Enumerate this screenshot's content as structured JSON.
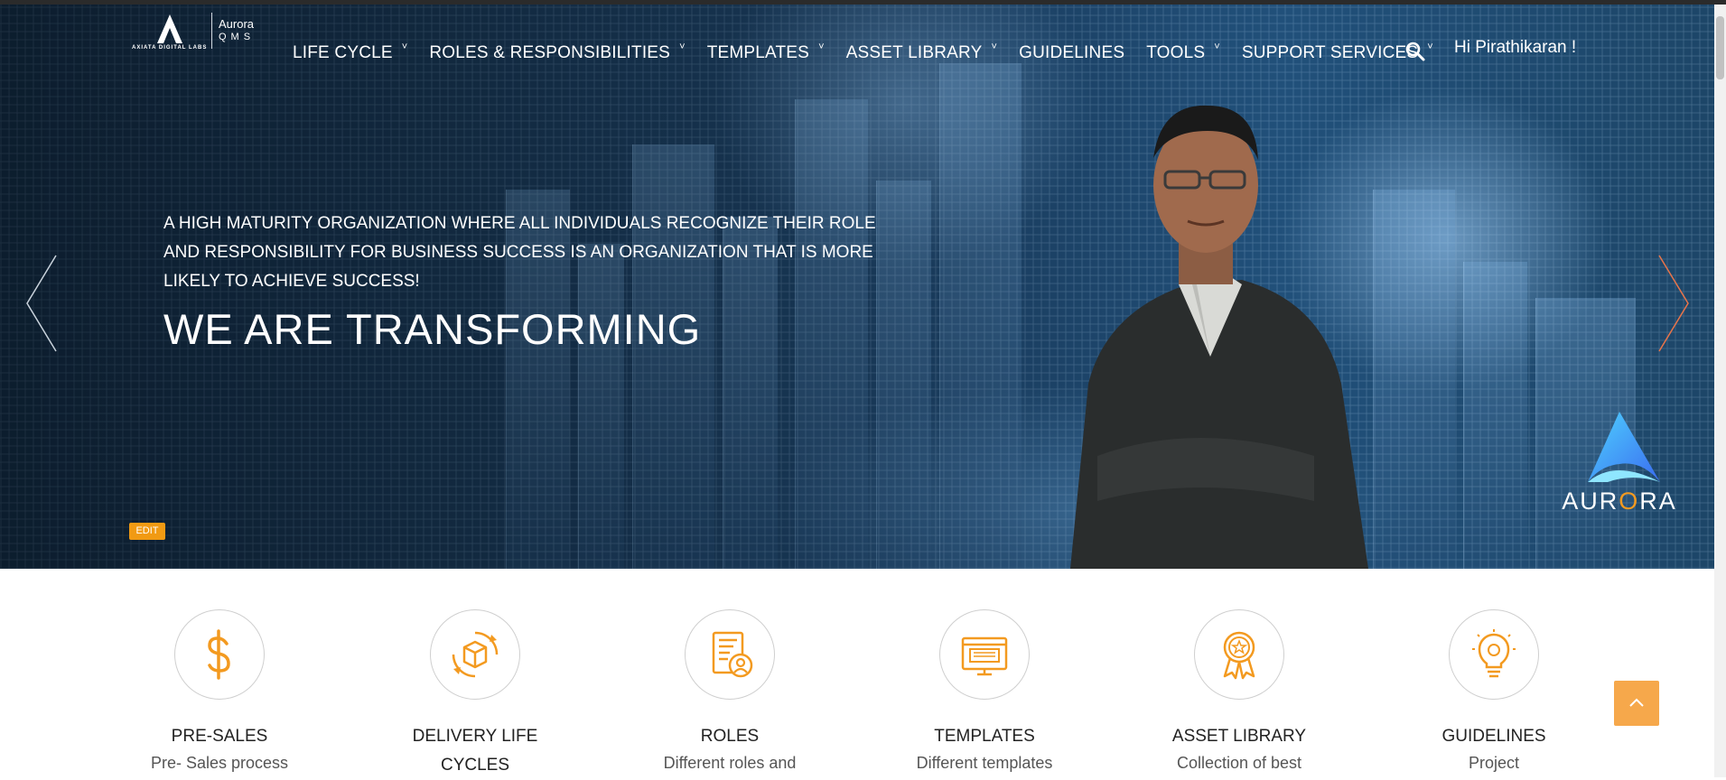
{
  "logo": {
    "brand_sub": "AXIATA DIGITAL LABS",
    "product_name": "Aurora",
    "product_suffix": "QMS"
  },
  "nav": {
    "items": [
      {
        "label": "LIFE CYCLE",
        "has_dropdown": true
      },
      {
        "label": "ROLES & RESPONSIBILITIES",
        "has_dropdown": true
      },
      {
        "label": "TEMPLATES",
        "has_dropdown": true
      },
      {
        "label": "ASSET LIBRARY",
        "has_dropdown": true
      },
      {
        "label": "GUIDELINES",
        "has_dropdown": false
      },
      {
        "label": "TOOLS",
        "has_dropdown": true
      },
      {
        "label": "SUPPORT SERVICES",
        "has_dropdown": true
      }
    ],
    "search_icon": "search-icon",
    "greeting": "Hi Pirathikaran !"
  },
  "hero": {
    "tagline": "A HIGH MATURITY ORGANIZATION WHERE ALL INDIVIDUALS RECOGNIZE THEIR ROLE AND RESPONSIBILITY FOR BUSINESS SUCCESS IS AN ORGANIZATION THAT IS MORE LIKELY TO ACHIEVE SUCCESS!",
    "headline": "WE ARE TRANSFORMING",
    "edit_label": "EDIT",
    "aurora_word_a": "AUR",
    "aurora_word_o": "O",
    "aurora_word_b": "RA"
  },
  "cards": [
    {
      "icon": "dollar-icon",
      "title": "PRE-SALES",
      "desc": "Pre- Sales process"
    },
    {
      "icon": "box-cycle-icon",
      "title": "DELIVERY LIFE CYCLES",
      "desc": ""
    },
    {
      "icon": "document-user-icon",
      "title": "ROLES",
      "desc": "Different roles and"
    },
    {
      "icon": "template-icon",
      "title": "TEMPLATES",
      "desc": "Different templates"
    },
    {
      "icon": "award-icon",
      "title": "ASSET LIBRARY",
      "desc": "Collection of best"
    },
    {
      "icon": "lightbulb-icon",
      "title": "GUIDELINES",
      "desc": "Project"
    }
  ],
  "colors": {
    "accent": "#f39a20",
    "edit": "#f19a13",
    "top_button": "#f6a84b"
  }
}
